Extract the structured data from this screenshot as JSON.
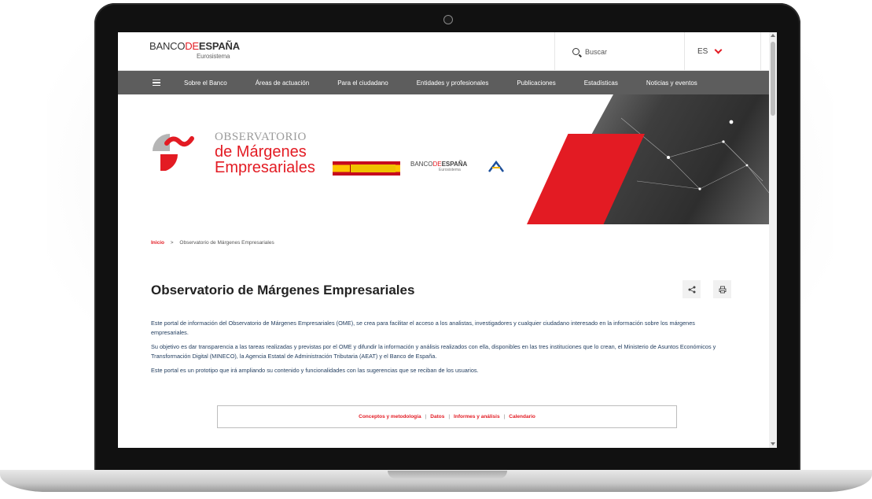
{
  "header": {
    "logo_pre": "BANCO",
    "logo_de": "DE",
    "logo_bold": "ESPAÑA",
    "logo_sub": "Eurosistema",
    "search_label": "Buscar",
    "lang": "ES"
  },
  "nav": {
    "items": [
      "Sobre el Banco",
      "Áreas de actuación",
      "Para el ciudadano",
      "Entidades y profesionales",
      "Publicaciones",
      "Estadísticas",
      "Noticias y eventos"
    ]
  },
  "hero": {
    "ome_line1": "OBSERVATORIO",
    "ome_line2": "de Márgenes",
    "ome_line3": "Empresariales",
    "bde_pre": "BANCO",
    "bde_de": "DE",
    "bde_bold": "ESPAÑA",
    "bde_sub": "Eurosistema"
  },
  "breadcrumb": {
    "home": "Inicio",
    "separator": ">",
    "current": "Observatorio de Márgenes Empresariales"
  },
  "page": {
    "title": "Observatorio de Márgenes Empresariales",
    "paragraphs": [
      "Este portal de información del Observatorio de Márgenes Empresariales (OME), se crea para facilitar el acceso a los analistas, investigadores y cualquier ciudadano interesado en la información sobre los márgenes empresariales.",
      "Su objetivo es dar transparencia a las tareas realizadas y previstas por el OME y difundir la información y análisis realizados con ella, disponibles en las tres instituciones que lo crean, el Ministerio de Asuntos Económicos y Transformación Digital (MINECO), la Agencia Estatal de Administración Tributaria (AEAT) y el Banco de España.",
      "Este portal es un prototipo que irá ampliando su contenido y funcionalidades con las sugerencias que se reciban de los usuarios."
    ]
  },
  "links": {
    "items": [
      "Conceptos y metodología",
      "Datos",
      "Informes y análisis",
      "Calendario"
    ],
    "separator": "|"
  },
  "icons": {
    "share": "share-icon",
    "print": "print-icon",
    "search": "search-icon",
    "menu": "menu-icon",
    "lang_toggle": "chevron-down-icon"
  },
  "colors": {
    "accent": "#e31b23",
    "nav_bg": "#5d5d5d",
    "text": "#1e3a5c"
  }
}
